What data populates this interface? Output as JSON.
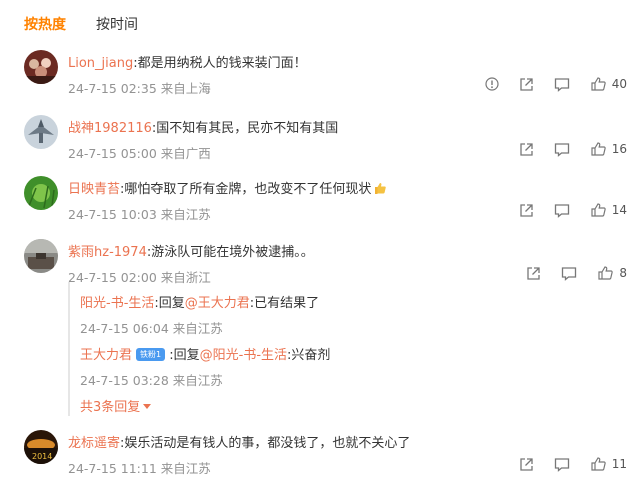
{
  "tabs": [
    {
      "label": "按热度",
      "active": true
    },
    {
      "label": "按时间",
      "active": false
    }
  ],
  "comments": [
    {
      "user": "Lion_jiang",
      "text": ":都是用纳税人的钱来装门面！",
      "time": "24-7-15 02:35",
      "location": "来自上海",
      "likes": "40"
    },
    {
      "user": "战神1982116",
      "text": ":国不知有其民，民亦不知有其国",
      "time": "24-7-15 05:00",
      "location": "来自广西",
      "likes": "16"
    },
    {
      "user": "日映青苔",
      "text": ":哪怕夺取了所有金牌，也改变不了任何现状",
      "time": "24-7-15 10:03",
      "location": "来自江苏",
      "likes": "14"
    },
    {
      "user": "紫雨hz-1974",
      "text": ":游泳队可能在境外被逮捕。。",
      "time": "24-7-15 02:00",
      "location": "来自浙江",
      "likes": "8"
    },
    {
      "user": "龙标遥寄",
      "text": ":娱乐活动是有钱人的事，都没钱了，也就不关心了",
      "time": "24-7-15 11:11",
      "location": "来自江苏",
      "likes": "11"
    }
  ],
  "replies": [
    {
      "user": "阳光-书-生活",
      "reply_word": ":回复",
      "target": "@王大力君",
      "text": ":已有结果了",
      "time": "24-7-15 06:04",
      "location": "来自江苏"
    },
    {
      "user": "王大力君",
      "badge": "铁粉1",
      "reply_word": ":回复",
      "target": "@阳光-书-生活",
      "text": ":兴奋剂",
      "time": "24-7-15 03:28",
      "location": "来自江苏"
    }
  ],
  "more_replies": "共3条回复",
  "colors": {
    "accent": "#ff8200",
    "username": "#eb7350",
    "meta": "#939393",
    "badge": "#4a9af0"
  }
}
